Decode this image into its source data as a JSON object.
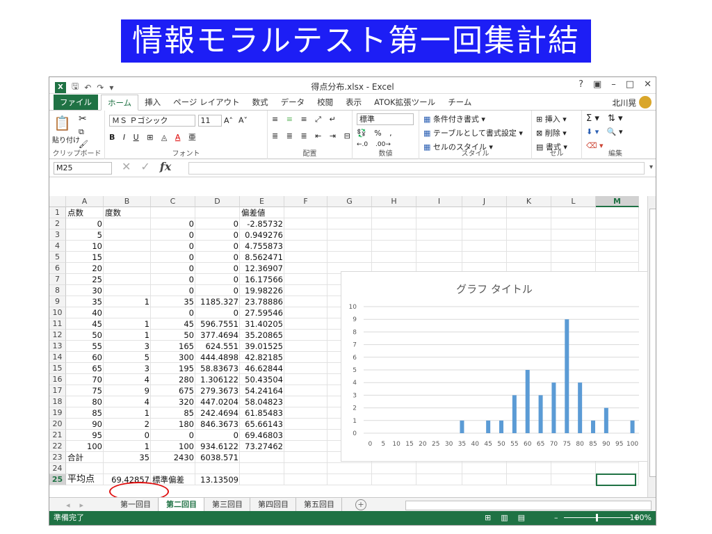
{
  "slide_title": "情報モラルテスト第一回集計結果",
  "window": {
    "title": "得点分布.xlsx - Excel",
    "user": "北川晃",
    "help": "?"
  },
  "menu": {
    "file": "ファイル",
    "tabs": [
      "ホーム",
      "挿入",
      "ページ レイアウト",
      "数式",
      "データ",
      "校閲",
      "表示",
      "ATOK拡張ツール",
      "チーム"
    ]
  },
  "ribbon": {
    "clipboard": {
      "paste": "貼り付け",
      "label": "クリップボード"
    },
    "font": {
      "name": "ＭＳ Ｐゴシック",
      "size": "11",
      "label": "フォント"
    },
    "alignment": {
      "label": "配置"
    },
    "number": {
      "format": "標準",
      "label": "数値"
    },
    "styles": {
      "conditional": "条件付き書式",
      "table": "テーブルとして書式設定",
      "cell": "セルのスタイル",
      "label": "スタイル"
    },
    "cells": {
      "insert": "挿入",
      "delete": "削除",
      "format": "書式",
      "label": "セル"
    },
    "editing": {
      "label": "編集"
    }
  },
  "formula_bar": {
    "name_box": "M25",
    "formula": ""
  },
  "columns": [
    "A",
    "B",
    "C",
    "D",
    "E",
    "F",
    "G",
    "H",
    "I",
    "J",
    "K",
    "L",
    "M"
  ],
  "rows": [
    {
      "a": "点数",
      "b": "度数",
      "c": "",
      "d": "",
      "e": "偏差値"
    },
    {
      "a": "0",
      "b": "",
      "c": "0",
      "d": "0",
      "e": "-2.85732"
    },
    {
      "a": "5",
      "b": "",
      "c": "0",
      "d": "0",
      "e": "0.949276"
    },
    {
      "a": "10",
      "b": "",
      "c": "0",
      "d": "0",
      "e": "4.755873"
    },
    {
      "a": "15",
      "b": "",
      "c": "0",
      "d": "0",
      "e": "8.562471"
    },
    {
      "a": "20",
      "b": "",
      "c": "0",
      "d": "0",
      "e": "12.36907"
    },
    {
      "a": "25",
      "b": "",
      "c": "0",
      "d": "0",
      "e": "16.17566"
    },
    {
      "a": "30",
      "b": "",
      "c": "0",
      "d": "0",
      "e": "19.98226"
    },
    {
      "a": "35",
      "b": "1",
      "c": "35",
      "d": "1185.327",
      "e": "23.78886"
    },
    {
      "a": "40",
      "b": "",
      "c": "0",
      "d": "0",
      "e": "27.59546"
    },
    {
      "a": "45",
      "b": "1",
      "c": "45",
      "d": "596.7551",
      "e": "31.40205"
    },
    {
      "a": "50",
      "b": "1",
      "c": "50",
      "d": "377.4694",
      "e": "35.20865"
    },
    {
      "a": "55",
      "b": "3",
      "c": "165",
      "d": "624.551",
      "e": "39.01525"
    },
    {
      "a": "60",
      "b": "5",
      "c": "300",
      "d": "444.4898",
      "e": "42.82185"
    },
    {
      "a": "65",
      "b": "3",
      "c": "195",
      "d": "58.83673",
      "e": "46.62844"
    },
    {
      "a": "70",
      "b": "4",
      "c": "280",
      "d": "1.306122",
      "e": "50.43504"
    },
    {
      "a": "75",
      "b": "9",
      "c": "675",
      "d": "279.3673",
      "e": "54.24164"
    },
    {
      "a": "80",
      "b": "4",
      "c": "320",
      "d": "447.0204",
      "e": "58.04823"
    },
    {
      "a": "85",
      "b": "1",
      "c": "85",
      "d": "242.4694",
      "e": "61.85483"
    },
    {
      "a": "90",
      "b": "2",
      "c": "180",
      "d": "846.3673",
      "e": "65.66143"
    },
    {
      "a": "95",
      "b": "0",
      "c": "0",
      "d": "0",
      "e": "69.46803"
    },
    {
      "a": "100",
      "b": "1",
      "c": "100",
      "d": "934.6122",
      "e": "73.27462"
    },
    {
      "a": "合計",
      "b": "35",
      "c": "2430",
      "d": "6038.571",
      "e": ""
    },
    {
      "a": "",
      "b": "",
      "c": "",
      "d": "",
      "e": ""
    },
    {
      "a": "平均点",
      "b": "69.42857",
      "c": "標準偏差",
      "d": "13.13509",
      "e": ""
    }
  ],
  "sheet_tabs": [
    "第一回目",
    "第二回目",
    "第三回目",
    "第四回目",
    "第五回目"
  ],
  "active_sheet": "第二回目",
  "status": {
    "ready": "準備完了",
    "zoom": "100%"
  },
  "chart_data": {
    "type": "bar",
    "title": "グラフ タイトル",
    "categories": [
      "0",
      "5",
      "10",
      "15",
      "20",
      "25",
      "30",
      "35",
      "40",
      "45",
      "50",
      "55",
      "60",
      "65",
      "70",
      "75",
      "80",
      "85",
      "90",
      "95",
      "100"
    ],
    "values": [
      0,
      0,
      0,
      0,
      0,
      0,
      0,
      1,
      0,
      1,
      1,
      3,
      5,
      3,
      4,
      9,
      4,
      1,
      2,
      0,
      1
    ],
    "ylim": [
      0,
      10
    ],
    "yticks": [
      0,
      1,
      2,
      3,
      4,
      5,
      6,
      7,
      8,
      9,
      10
    ],
    "grid": true,
    "bar_color": "#5b9bd5",
    "xlabel": "",
    "ylabel": ""
  }
}
